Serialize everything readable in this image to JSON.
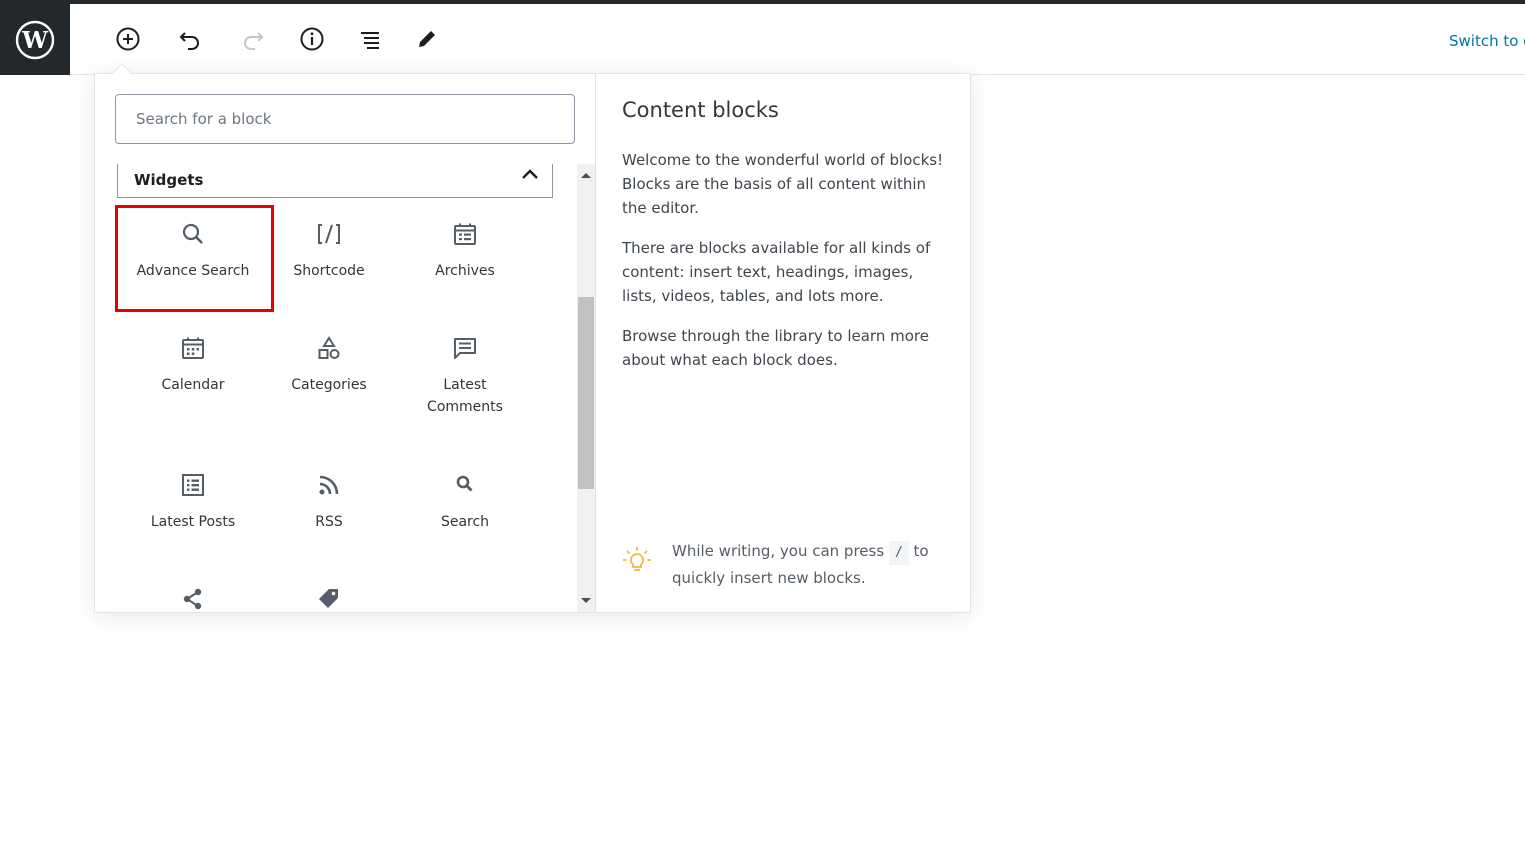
{
  "toolbar": {
    "switch_label": "Switch to d"
  },
  "inserter": {
    "search_placeholder": "Search for a block",
    "panel_title": "Widgets",
    "blocks": [
      {
        "label": "Advance Search",
        "icon": "search-icon"
      },
      {
        "label": "Shortcode",
        "icon": "shortcode-icon"
      },
      {
        "label": "Archives",
        "icon": "archives-icon"
      },
      {
        "label": "Calendar",
        "icon": "calendar-icon"
      },
      {
        "label": "Categories",
        "icon": "categories-icon"
      },
      {
        "label": "Latest Comments",
        "icon": "comment-icon"
      },
      {
        "label": "Latest Posts",
        "icon": "list-icon"
      },
      {
        "label": "RSS",
        "icon": "rss-icon"
      },
      {
        "label": "Search",
        "icon": "search-small-icon"
      },
      {
        "label": "",
        "icon": "share-icon"
      },
      {
        "label": "",
        "icon": "tag-icon"
      }
    ]
  },
  "help": {
    "title": "Content blocks",
    "paragraphs": [
      "Welcome to the wonderful world of blocks! Blocks are the basis of all content within the editor.",
      "There are blocks available for all kinds of content: insert text, headings, images, lists, videos, tables, and lots more.",
      "Browse through the library to learn more about what each block does."
    ],
    "tip_before": "While writing, you can press",
    "tip_key": "/",
    "tip_after": "to quickly insert new blocks."
  },
  "colors": {
    "highlight": "#e60000",
    "link": "#0073aa",
    "tip_icon": "#f0b849"
  }
}
